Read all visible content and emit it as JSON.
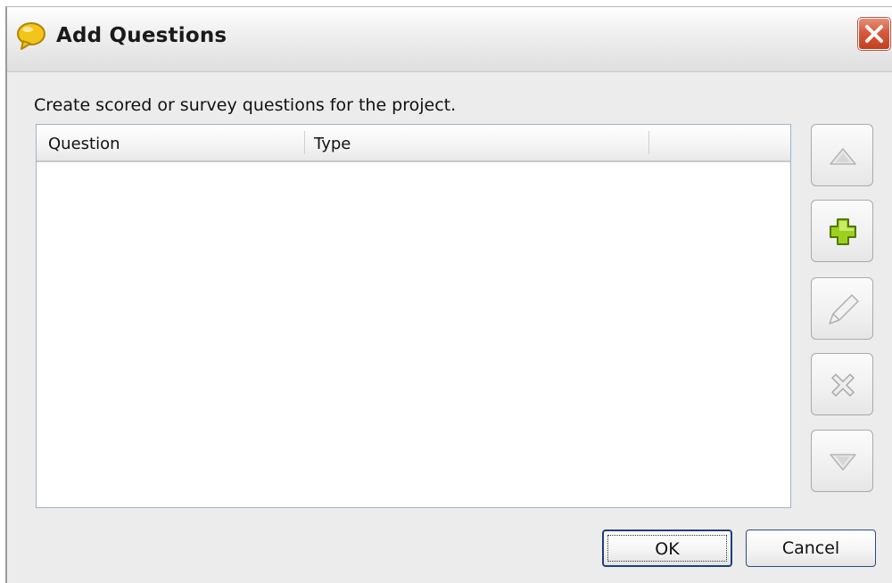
{
  "window": {
    "title": "Add Questions",
    "icon": "yellow-bubble-icon",
    "close_icon": "close-x-icon"
  },
  "instruction": "Create scored or survey questions for the project.",
  "table": {
    "columns": [
      "Question",
      "Type"
    ],
    "rows": []
  },
  "side_buttons": [
    {
      "name": "move-up-button",
      "icon": "triangle-up-icon",
      "enabled": false
    },
    {
      "name": "add-button",
      "icon": "plus-icon",
      "enabled": true,
      "color": "#9ad11f"
    },
    {
      "name": "edit-button",
      "icon": "pencil-icon",
      "enabled": false
    },
    {
      "name": "delete-button",
      "icon": "x-icon",
      "enabled": false
    },
    {
      "name": "move-down-button",
      "icon": "triangle-down-icon",
      "enabled": false
    }
  ],
  "buttons": {
    "ok": "OK",
    "cancel": "Cancel"
  },
  "colors": {
    "close_button": "#d55a3d",
    "add_icon": "#9ad11f",
    "table_border": "#9fb4c7",
    "ok_border": "#1d3f7d"
  }
}
